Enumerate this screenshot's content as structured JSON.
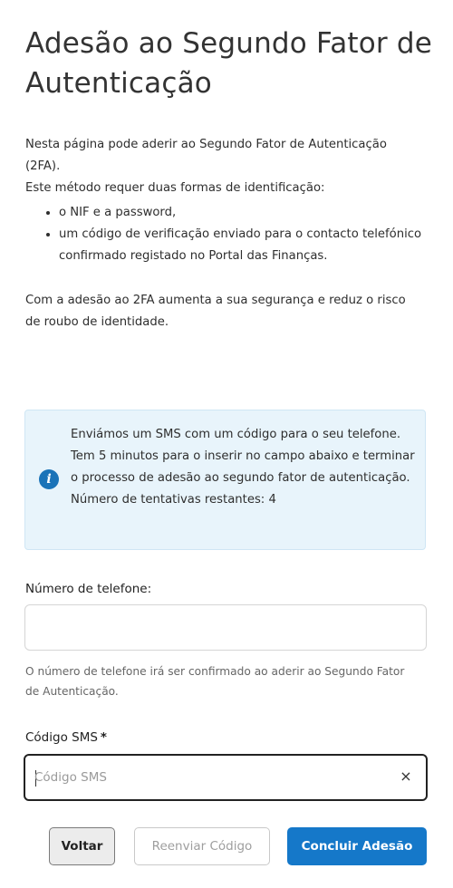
{
  "page": {
    "title": "Adesão ao Segundo Fator de Autenticação"
  },
  "intro": {
    "line1": "Nesta página pode aderir ao Segundo Fator de Autenticação (2FA).",
    "line2": "Este método requer duas formas de identificação:",
    "bullets": [
      "o NIF e a password,",
      "um código de verificação enviado para o contacto telefónico confirmado registado no Portal das Finanças."
    ],
    "para2": "Com a adesão ao 2FA aumenta a sua segurança e reduz o risco de roubo de identidade."
  },
  "info_box": {
    "icon": "info-icon",
    "message": "Enviámos um SMS com um código para o seu telefone. Tem 5 minutos para o inserir no campo abaixo e terminar o processo de adesão ao segundo fator de autenticação.",
    "attempts": "Número de tentativas restantes: 4"
  },
  "phone": {
    "label": "Número de telefone:",
    "value": "",
    "help": "O número de telefone irá ser confirmado ao aderir ao Segundo Fator de Autenticação."
  },
  "sms": {
    "label": "Código SMS",
    "required_mark": "*",
    "placeholder": "Código SMS",
    "value": "",
    "clear_icon": "×"
  },
  "buttons": {
    "back": "Voltar",
    "resend": "Reenviar Código",
    "finish": "Concluir Adesão"
  },
  "colors": {
    "primary": "#1578c9",
    "info_bg": "#e8f4fb",
    "info_icon": "#1a73b8"
  }
}
